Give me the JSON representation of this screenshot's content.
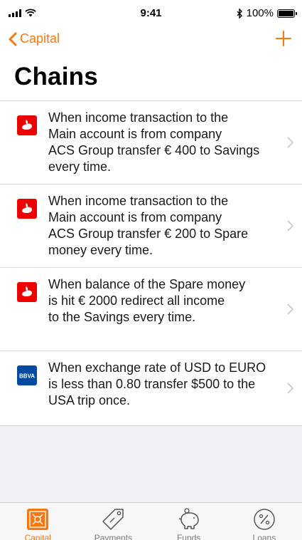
{
  "status_bar": {
    "time": "9:41",
    "battery": "100%",
    "bluetooth": "bluetooth-icon"
  },
  "nav": {
    "back_label": "Capital",
    "add_icon": "plus-icon"
  },
  "page_title": "Chains",
  "chains": [
    {
      "bank": "santander",
      "icon": "santander-logo-icon",
      "lines": [
        "When income transaction to the",
        "Main account is from company",
        "ACS Group transfer € 400 to Savings",
        "every time."
      ]
    },
    {
      "bank": "santander",
      "icon": "santander-logo-icon",
      "lines": [
        "When income transaction to the",
        "Main account is from company",
        "ACS Group transfer € 200 to Spare",
        "money every time."
      ]
    },
    {
      "bank": "santander",
      "icon": "santander-logo-icon",
      "lines": [
        "When balance of the Spare money",
        "is hit € 2000 redirect all income",
        "to the Savings every time."
      ]
    },
    {
      "bank": "bbva",
      "icon": "bbva-logo-icon",
      "logo_text": "BBVA",
      "lines": [
        "When exchange rate of USD to EURO",
        "is less than 0.80 transfer $500 to the",
        "USA trip once."
      ]
    }
  ],
  "tabs": [
    {
      "label": "Capital",
      "icon": "safe-icon",
      "active": true
    },
    {
      "label": "Payments",
      "icon": "tag-icon",
      "active": false
    },
    {
      "label": "Funds",
      "icon": "piggy-bank-icon",
      "active": false
    },
    {
      "label": "Loans",
      "icon": "percent-icon",
      "active": false
    }
  ],
  "colors": {
    "accent": "#f7780f",
    "santander_red": "#ec0000",
    "bbva_blue": "#004a9f",
    "background": "#efeff4"
  }
}
